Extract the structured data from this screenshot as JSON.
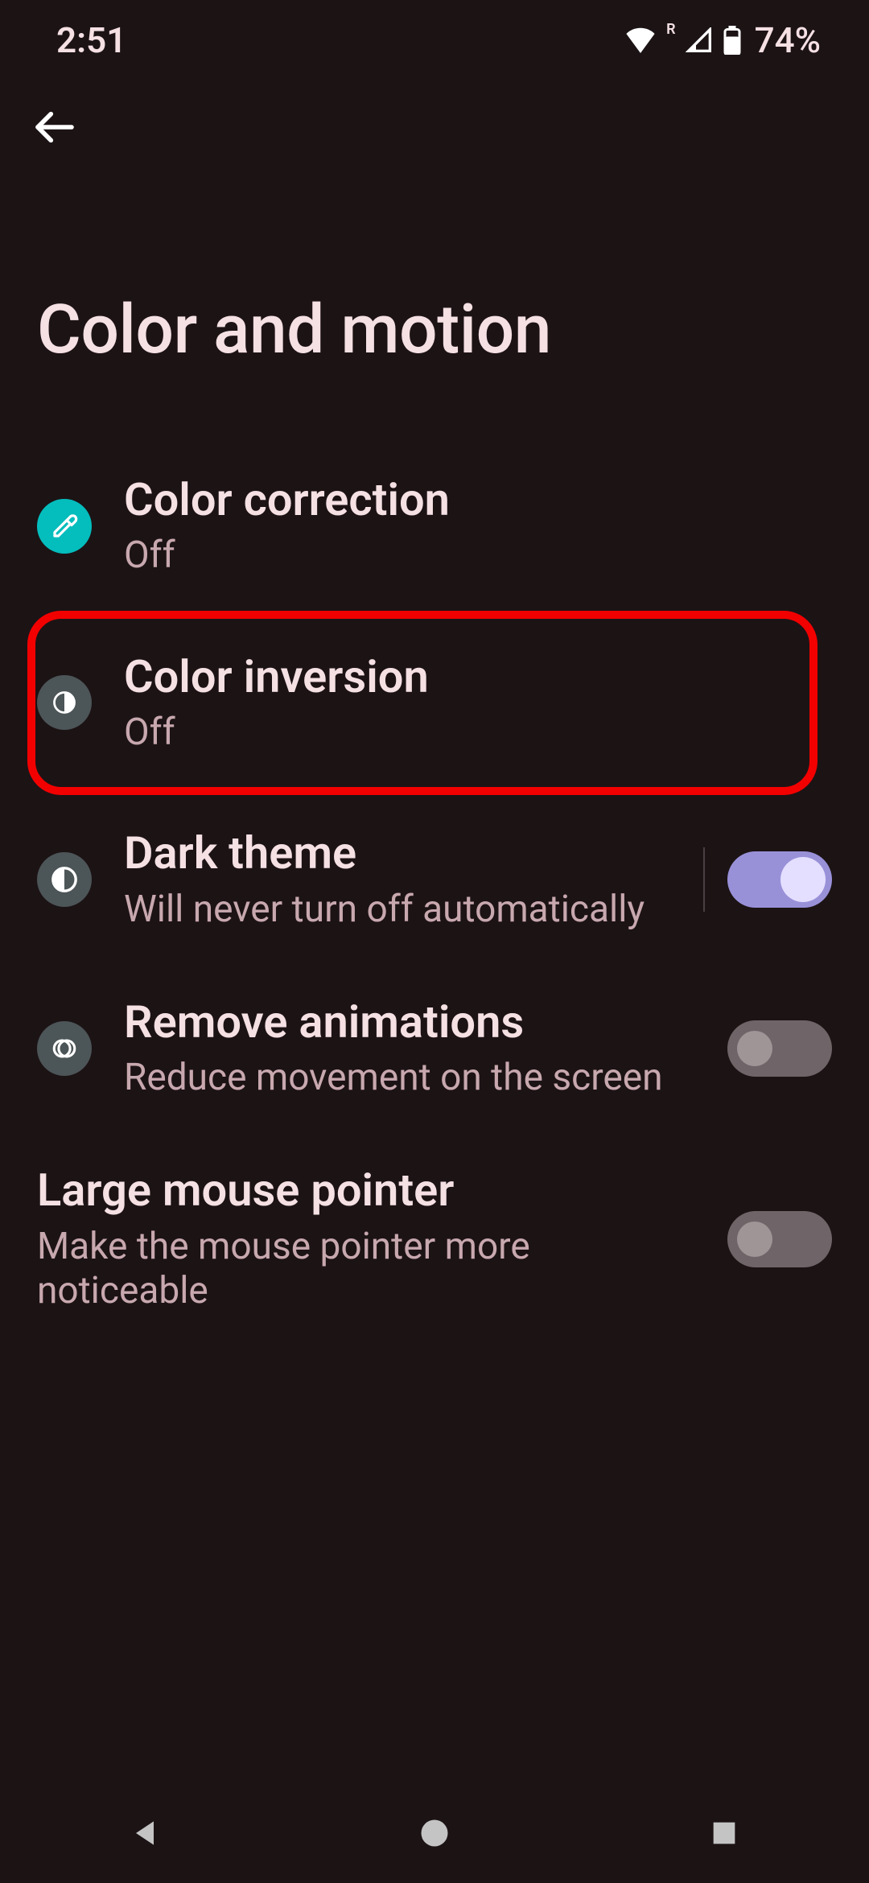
{
  "statusbar": {
    "time": "2:51",
    "battery_percent": "74%",
    "r_label": "R"
  },
  "page": {
    "title": "Color and motion"
  },
  "items": {
    "color_correction": {
      "title": "Color correction",
      "sub": "Off"
    },
    "color_inversion": {
      "title": "Color inversion",
      "sub": "Off"
    },
    "dark_theme": {
      "title": "Dark theme",
      "sub": "Will never turn off automatically",
      "enabled": true
    },
    "remove_animations": {
      "title": "Remove animations",
      "sub": "Reduce movement on the screen",
      "enabled": false
    },
    "large_mouse": {
      "title": "Large mouse pointer",
      "sub": "Make the mouse pointer more noticeable",
      "enabled": false
    }
  },
  "colors": {
    "highlight": "#f20000"
  }
}
